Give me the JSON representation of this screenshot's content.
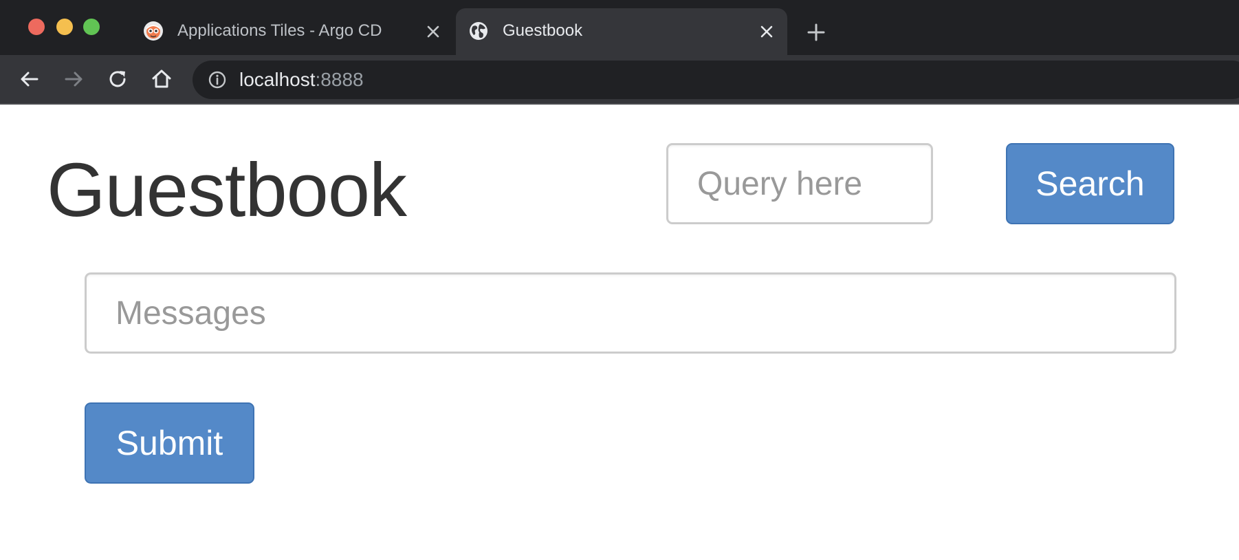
{
  "browser": {
    "tabs": [
      {
        "title": "Applications Tiles - Argo CD",
        "favicon": "argo-octopus-icon",
        "active": false
      },
      {
        "title": "Guestbook",
        "favicon": "globe-icon",
        "active": true
      }
    ],
    "address": {
      "host": "localhost",
      "port": ":8888"
    }
  },
  "page": {
    "title": "Guestbook",
    "search": {
      "placeholder": "Query here",
      "value": "",
      "button_label": "Search"
    },
    "message": {
      "placeholder": "Messages",
      "value": ""
    },
    "submit_label": "Submit"
  },
  "colors": {
    "primary_button": "#5489c8",
    "heading_text": "#333333",
    "placeholder_text": "#999999",
    "tab_strip": "#202124",
    "toolbar": "#35363a"
  }
}
